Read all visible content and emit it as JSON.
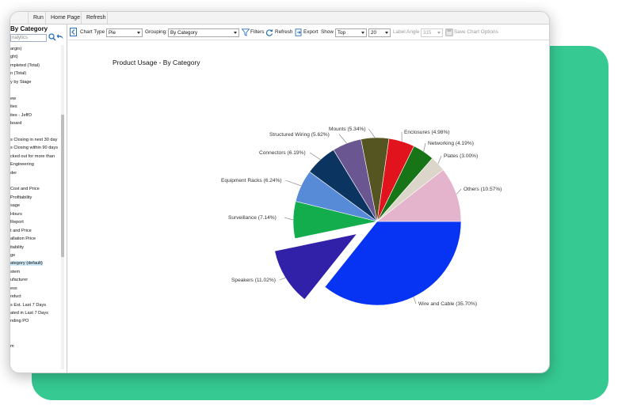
{
  "menu": {
    "items": [
      "Run",
      "Home Page",
      "Refresh"
    ]
  },
  "sidebar": {
    "title": "By Category",
    "search_placeholder": "nalytics",
    "items": [
      "argin)",
      "ght)",
      "mpleted (Total)",
      "n (Total)",
      "y by Stage",
      "",
      "ew",
      "ites",
      "ites - JeffO",
      "board",
      "",
      "s Closing in next 30 day",
      "s Closing within 90 days",
      "cked out for more than",
      "Engineering",
      "der",
      "",
      "Cost and Price",
      "Profitability",
      "sage",
      "Hours",
      "Report",
      "t and Price",
      "allation Price",
      "itability",
      "ge",
      "ategory (default)",
      "stem",
      "ufacturer",
      "ess",
      "oduct",
      "s Est. Last 7 Days",
      "ated in Last 7 Days",
      "nding PO",
      "",
      "",
      "m"
    ],
    "selected_index": 26
  },
  "toolbar": {
    "chart_type_label": "Chart Type",
    "chart_type_value": "Pie",
    "grouping_label": "Grouping:",
    "grouping_value": "By Category",
    "filters_label": "Filters",
    "refresh_label": "Refresh",
    "export_label": "Export",
    "show_label": "Show",
    "show_value": "Top",
    "count_value": "20",
    "label_angle_label": "Label Angle",
    "label_angle_value": "315",
    "save_chart_label": "Save Chart Options"
  },
  "chart_data": {
    "type": "pie",
    "title": "Product Usage - By Category",
    "slices": [
      {
        "label": "Wire and Cable",
        "percent": 35.7,
        "display": "Wire and Cable (35.70%)",
        "color": "#0634f2",
        "exploded": false
      },
      {
        "label": "Speakers",
        "percent": 11.02,
        "display": "Speakers (11.02%)",
        "color": "#3120a8",
        "exploded": true
      },
      {
        "label": "Surveillance",
        "percent": 7.14,
        "display": "Surveillance (7.14%)",
        "color": "#14ad4d",
        "exploded": false
      },
      {
        "label": "Equipment Racks",
        "percent": 6.24,
        "display": "Equipment Racks (6.24%)",
        "color": "#578bd8",
        "exploded": false
      },
      {
        "label": "Connectors",
        "percent": 6.19,
        "display": "Connectors (6.19%)",
        "color": "#0b3560",
        "exploded": false
      },
      {
        "label": "Structured Wiring",
        "percent": 5.62,
        "display": "Structured Wiring (5.62%)",
        "color": "#6a5690",
        "exploded": false
      },
      {
        "label": "Mounts",
        "percent": 5.34,
        "display": "Mounts (5.34%)",
        "color": "#555522",
        "exploded": false
      },
      {
        "label": "Enclosures",
        "percent": 4.98,
        "display": "Enclosures (4.98%)",
        "color": "#e1141e",
        "exploded": false
      },
      {
        "label": "Networking",
        "percent": 4.19,
        "display": "Networking (4.19%)",
        "color": "#177518",
        "exploded": false
      },
      {
        "label": "Plates",
        "percent": 3.0,
        "display": "Plates (3.00%)",
        "color": "#dcd5c9",
        "exploded": false
      },
      {
        "label": "Others",
        "percent": 10.57,
        "display": "Others (10.57%)",
        "color": "#e4b4cc",
        "exploded": false
      }
    ]
  }
}
